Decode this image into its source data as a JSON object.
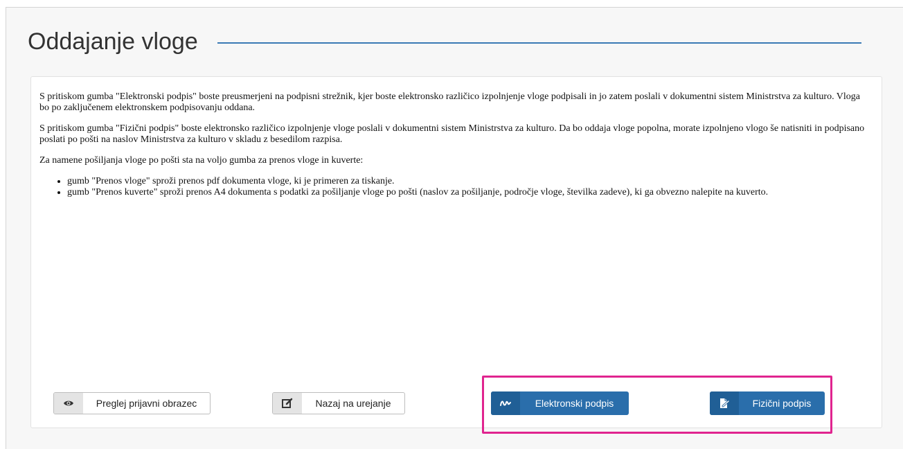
{
  "page": {
    "title": "Oddajanje vloge"
  },
  "instructions": {
    "paragraph_1": "S pritiskom gumba \"Elektronski podpis\" boste preusmerjeni na podpisni strežnik, kjer boste elektronsko različico izpolnjenje vloge podpisali in jo zatem poslali v dokumentni sistem Ministrstva za kulturo. Vloga bo po zaključenem elektronskem podpisovanju oddana.",
    "paragraph_2": "S pritiskom gumba \"Fizični podpis\" boste elektronsko različico izpolnjenje vloge poslali v dokumentni sistem Ministrstva za kulturo. Da bo oddaja vloge popolna, morate izpolnjeno vlogo še natisniti in podpisano poslati po pošti na naslov Ministrstva za kulturo v skladu z besedilom razpisa.",
    "paragraph_3": "Za namene pošiljanja vloge po pošti sta na voljo gumba za prenos vloge in kuverte:",
    "bullets": [
      "gumb \"Prenos vloge\" sproži prenos pdf dokumenta vloge, ki je primeren za tiskanje.",
      "gumb \"Prenos kuverte\" sproži prenos A4 dokumenta s podatki za pošiljanje vloge po pošti (naslov za pošiljanje, področje vloge, številka zadeve), ki ga obvezno nalepite na kuverto."
    ]
  },
  "actions": {
    "preview": {
      "label": "Preglej prijavni obrazec",
      "icon": "eye-icon"
    },
    "back_to_edit": {
      "label": "Nazaj na urejanje",
      "icon": "edit-icon"
    },
    "electronic_sign": {
      "label": "Elektronski podpis",
      "icon": "signature-icon"
    },
    "physical_sign": {
      "label": "Fizični podpis",
      "icon": "sign-document-icon"
    }
  },
  "colors": {
    "primary_button": "#2a6eab",
    "primary_button_icon_bg": "#205f96",
    "title_rule": "#3a7ab5",
    "highlight": "#e0248f"
  }
}
